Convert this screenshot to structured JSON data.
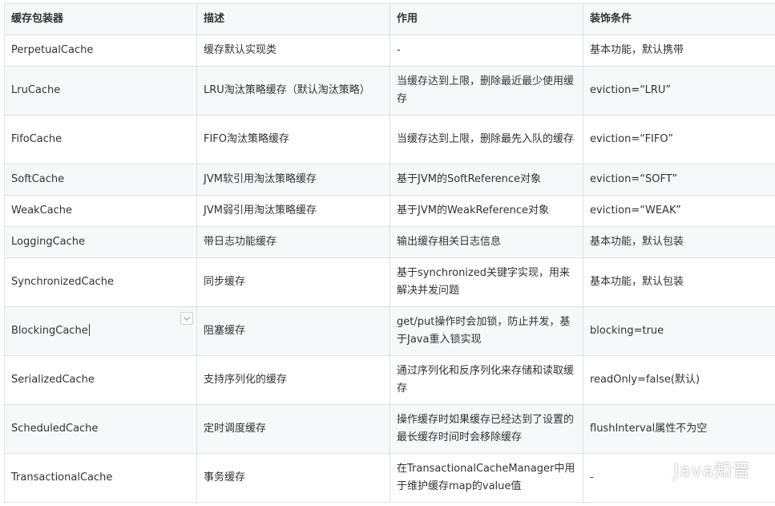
{
  "table": {
    "headers": [
      "缓存包装器",
      "描述",
      "作用",
      "装饰条件"
    ],
    "rows": [
      [
        "PerpetualCache",
        "缓存默认实现类",
        "-",
        "基本功能，默认携带"
      ],
      [
        "LruCache",
        "LRU淘汰策略缓存（默认淘汰策略）",
        "当缓存达到上限，删除最近最少使用缓存",
        "eviction=“LRU”"
      ],
      [
        "FifoCache",
        "FIFO淘汰策略缓存",
        "当缓存达到上限，删除最先入队的缓存",
        "eviction=“FIFO”"
      ],
      [
        "SoftCache",
        "JVM软引用淘汰策略缓存",
        "基于JVM的SoftReference对象",
        "eviction=“SOFT”"
      ],
      [
        "WeakCache",
        "JVM弱引用淘汰策略缓存",
        "基于JVM的WeakReference对象",
        "eviction=“WEAK”"
      ],
      [
        "LoggingCache",
        "带日志功能缓存",
        "输出缓存相关日志信息",
        "基本功能，默认包装"
      ],
      [
        "SynchronizedCache",
        "同步缓存",
        "基于synchronized关键字实现，用来解决并发问题",
        "基本功能，默认包装"
      ],
      [
        "BlockingCache",
        "阻塞缓存",
        "get/put操作时会加锁，防止并发，基于Java重入锁实现",
        "blocking=true"
      ],
      [
        "SerializedCache",
        "支持序列化的缓存",
        "通过序列化和反序列化来存储和读取缓存",
        "readOnly=false(默认)"
      ],
      [
        "ScheduledCache",
        "定时调度缓存",
        "操作缓存时如果缓存已经达到了设置的最长缓存时间时会移除缓存",
        "flushInterval属性不为空"
      ],
      [
        "TransactionalCache",
        "事务缓存",
        "在TransactionalCacheManager中用于维护缓存map的value值",
        "-"
      ]
    ]
  },
  "watermark": {
    "text": "Java知音",
    "icon": "wechat-icon"
  },
  "colors": {
    "header_bg": "#f6f8fa",
    "border": "#dfe2e5",
    "stripe": "#f7f8f9",
    "text": "#333333"
  }
}
